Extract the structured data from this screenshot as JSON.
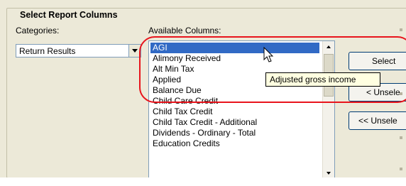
{
  "group": {
    "title": "Select Report Columns"
  },
  "categories": {
    "label": "Categories:",
    "selected": "Return Results"
  },
  "available": {
    "label": "Available Columns:",
    "items": [
      "AGI",
      "Alimony Received",
      "Alt Min Tax",
      "Applied",
      "Balance Due",
      "Child Care Credit",
      "Child Tax Credit",
      "Child Tax Credit - Additional",
      "Dividends - Ordinary - Total",
      "Education Credits"
    ],
    "selected_index": 0
  },
  "buttons": {
    "select": "Select",
    "unselect": "< Unsele",
    "unselect_all": "<< Unsele"
  },
  "tooltip": {
    "text": "Adjusted gross income"
  },
  "colors": {
    "selection": "#316ac5",
    "highlight_outline": "#e8141c",
    "tooltip_bg": "#ffffe1"
  },
  "icons": {
    "cursor": "arrow-cursor-icon",
    "combo_dropdown": "chevron-down-icon"
  }
}
